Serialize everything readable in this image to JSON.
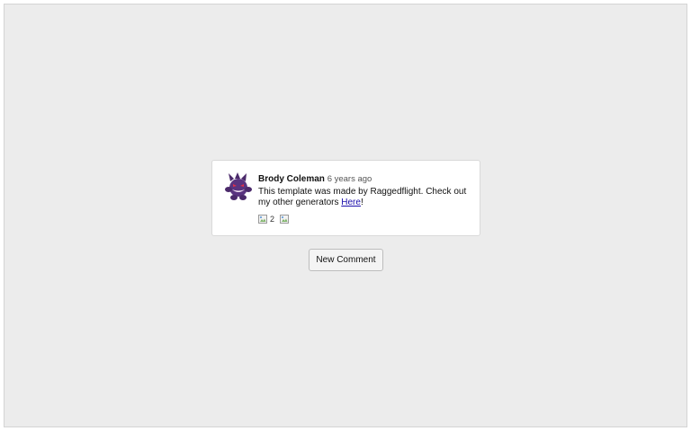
{
  "comment": {
    "author": "Brody Coleman",
    "time": "6 years ago",
    "text_before": "This template was made by Raggedflight. Check out my other generators ",
    "link_text": "Here",
    "text_after": "!",
    "likes": "2",
    "avatar_icon": "purple-ghost-avatar",
    "like_icon": "broken-image-icon",
    "reply_icon": "broken-image-icon"
  },
  "new_comment_button": "New Comment"
}
